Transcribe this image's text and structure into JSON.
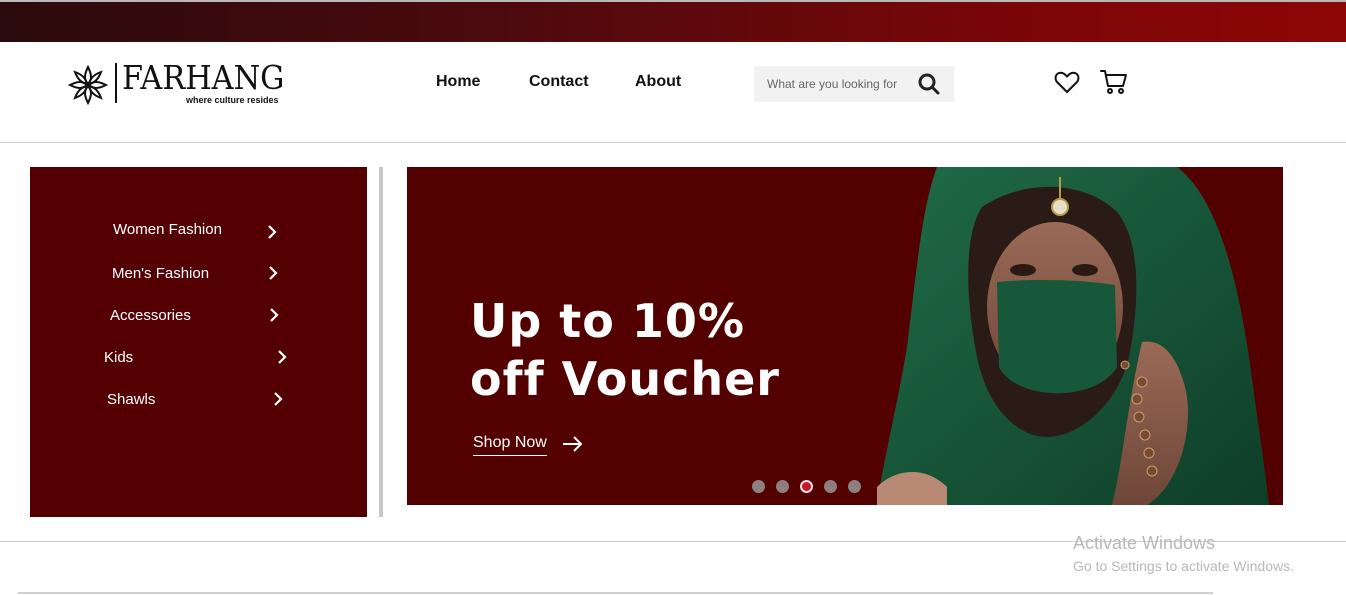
{
  "brand": {
    "name": "FARHANG",
    "tagline": "where culture resides"
  },
  "nav": {
    "items": [
      {
        "label": "Home"
      },
      {
        "label": "Contact"
      },
      {
        "label": "About"
      }
    ]
  },
  "search": {
    "placeholder": "What are you looking for",
    "icon": "search-icon"
  },
  "header_icons": {
    "wishlist": "heart-icon",
    "cart": "cart-icon"
  },
  "sidebar": {
    "items": [
      {
        "label": "Women Fashion",
        "icon": "chevron-right-icon"
      },
      {
        "label": "Men's Fashion",
        "icon": "chevron-right-icon"
      },
      {
        "label": "Accessories",
        "icon": "chevron-right-icon"
      },
      {
        "label": "Kids",
        "icon": "chevron-right-icon"
      },
      {
        "label": "Shawls",
        "icon": "chevron-right-icon"
      }
    ]
  },
  "banner": {
    "headline_line1": "Up to 10%",
    "headline_line2": "off Voucher",
    "cta_label": "Shop Now",
    "cta_icon": "arrow-right-icon",
    "slide_count": 5,
    "active_slide": 3
  },
  "watermark": {
    "line1": "Activate Windows",
    "line2": "Go to Settings to activate Windows."
  },
  "colors": {
    "brand_maroon": "#540003",
    "banner_bg": "#520000",
    "active_dot": "#c8142a"
  }
}
